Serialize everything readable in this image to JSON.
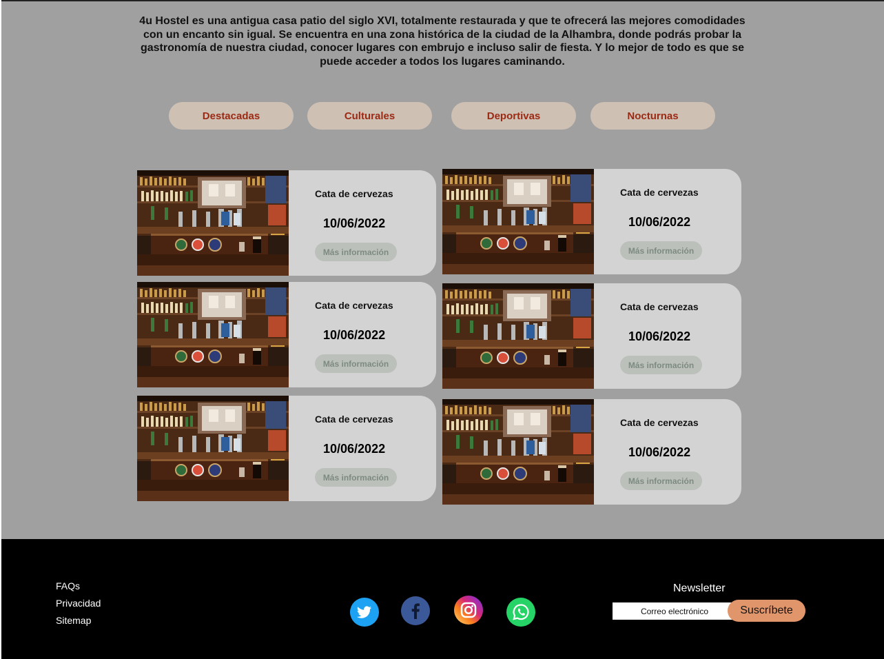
{
  "intro": {
    "text": "4u Hostel es una antigua casa patio del siglo XVI, totalmente restaurada y que te ofrecerá las mejores comodidades con un encanto sin igual. Se encuentra en una zona histórica de la ciudad de la Alhambra, donde podrás probar la gastronomía de nuestra ciudad, conocer lugares con embrujo e incluso salir de fiesta. Y lo mejor de todo es que se puede acceder a todos los lugares caminando."
  },
  "tabs": [
    {
      "label": "Destacadas"
    },
    {
      "label": "Culturales"
    },
    {
      "label": "Deportivas"
    },
    {
      "label": "Nocturnas"
    }
  ],
  "events": [
    {
      "title": "Cata de cervezas",
      "date": "10/06/2022",
      "button": "Más información"
    },
    {
      "title": "Cata de cervezas",
      "date": "10/06/2022",
      "button": "Más información"
    },
    {
      "title": "Cata de cervezas",
      "date": "10/06/2022",
      "button": "Más información"
    },
    {
      "title": "Cata de cervezas",
      "date": "10/06/2022",
      "button": "Más información"
    },
    {
      "title": "Cata de cervezas",
      "date": "10/06/2022",
      "button": "Más información"
    },
    {
      "title": "Cata de cervezas",
      "date": "10/06/2022",
      "button": "Más información"
    }
  ],
  "footer": {
    "links": [
      "FAQs",
      "Privacidad",
      "Sitemap"
    ],
    "social": [
      {
        "icon": "twitter-icon",
        "color": "#1da1f2"
      },
      {
        "icon": "facebook-icon",
        "color": "#3b5998"
      },
      {
        "icon": "instagram-icon",
        "color": "#e1306c"
      },
      {
        "icon": "whatsapp-icon",
        "color": "#25d366"
      }
    ],
    "newsletter": {
      "title": "Newsletter",
      "placeholder": "Correo electrónico",
      "button": "Suscríbete"
    }
  },
  "colors": {
    "page_background": "#a0a0a0",
    "tab_background": "#cfc0b4",
    "tab_text": "#9b2a14",
    "card_background": "#d3d3d3",
    "subscribe_button": "#e0956a",
    "footer_background": "#000000"
  }
}
